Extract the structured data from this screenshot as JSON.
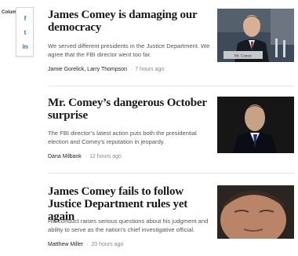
{
  "section_label": "Column",
  "share": {
    "icons": [
      "facebook-icon",
      "twitter-icon",
      "linkedin-icon"
    ],
    "facebook_glyph": "f",
    "twitter_glyph": "t",
    "linkedin_glyph": "in",
    "color": "#1f7ab8"
  },
  "articles": [
    {
      "headline": "James Comey is damaging our democracy",
      "blurb": "We served different presidents in the Justice Department. We agree that the FBI director went too far.",
      "authors": "Jamie Gorelick, Larry Thompson",
      "separator": "·",
      "time": "7 hours ago",
      "photo_caption": "Mr. Comey"
    },
    {
      "headline": "Mr. Comey’s dangerous October surprise",
      "blurb": "The FBI director’s latest action puts both the presidential election and Comey’s reputation in jeopardy.",
      "authors": "Dana Milbank",
      "separator": "·",
      "time": "12 hours ago"
    },
    {
      "headline": "James Comey fails to follow Justice Department rules yet again",
      "blurb": "His conduct raises serious questions about his judgment and ability to serve as the nation’s chief investigative official.",
      "authors": "Matthew Miller",
      "separator": "·",
      "time": "20 hours ago"
    }
  ]
}
